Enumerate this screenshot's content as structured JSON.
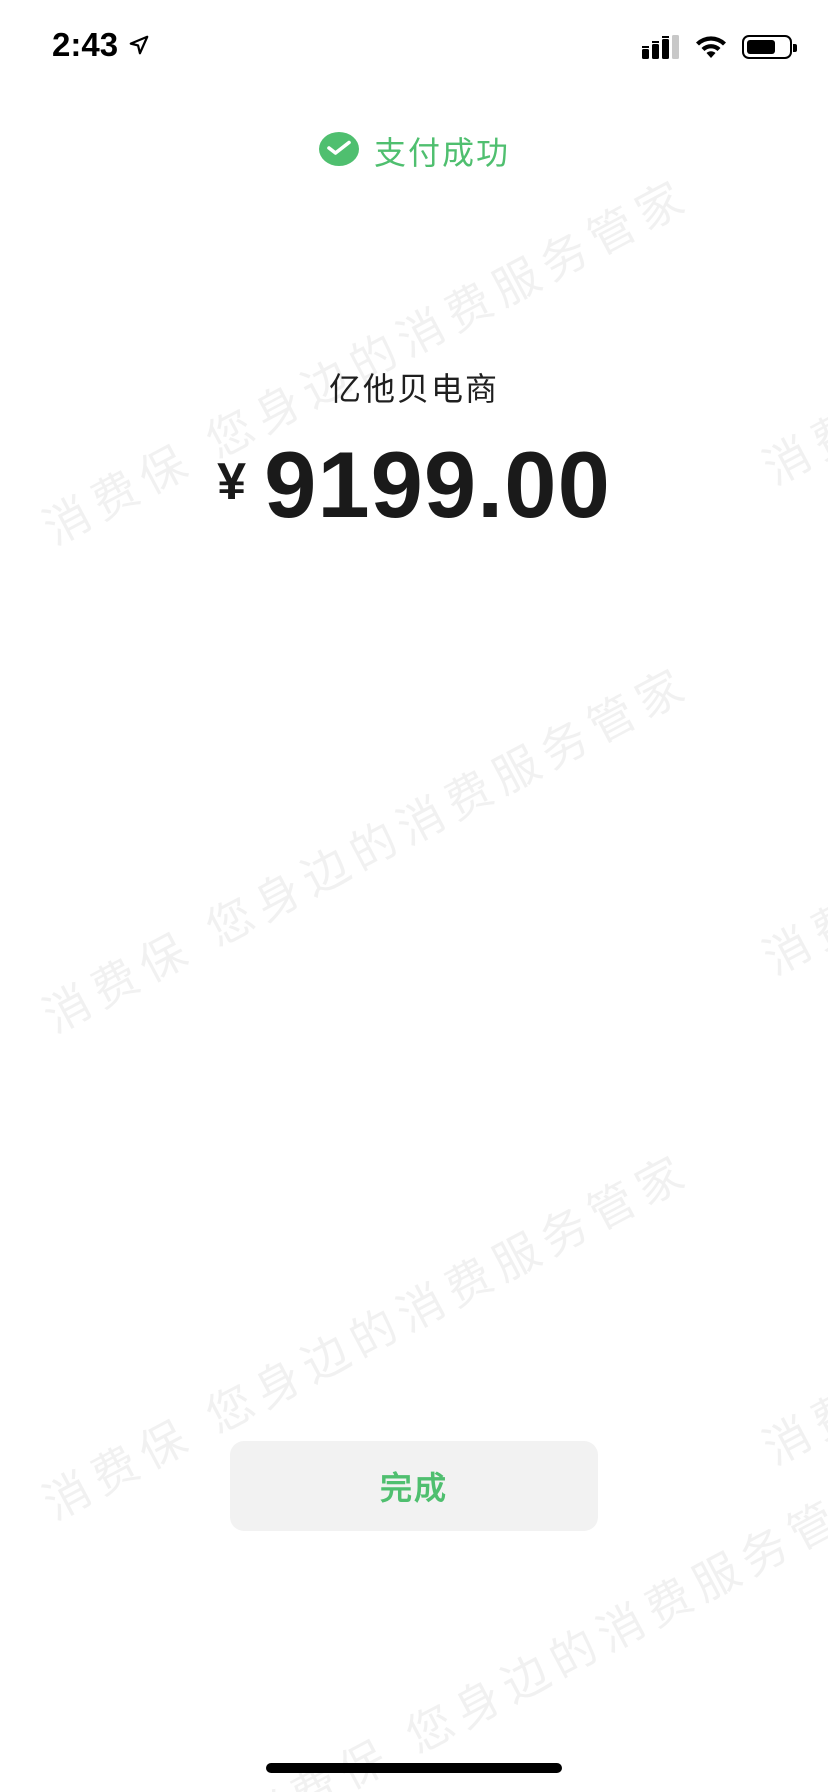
{
  "status_bar": {
    "time": "2:43",
    "icons": [
      "location-arrow-icon",
      "cellular-signal-icon",
      "wifi-icon",
      "battery-icon"
    ]
  },
  "header": {
    "icon": "wechat-pay-icon",
    "status": "支付成功"
  },
  "payment": {
    "merchant": "亿他贝电商",
    "currency_symbol": "¥",
    "amount": "9199.00"
  },
  "actions": {
    "done_label": "完成"
  },
  "watermark": {
    "text_line": "消费保 您身边的消费服务管家",
    "edge_fragment": "消费"
  },
  "colors": {
    "accent": "#4fbf6f",
    "button_bg": "#f2f2f2",
    "text": "#1a1a1a"
  }
}
